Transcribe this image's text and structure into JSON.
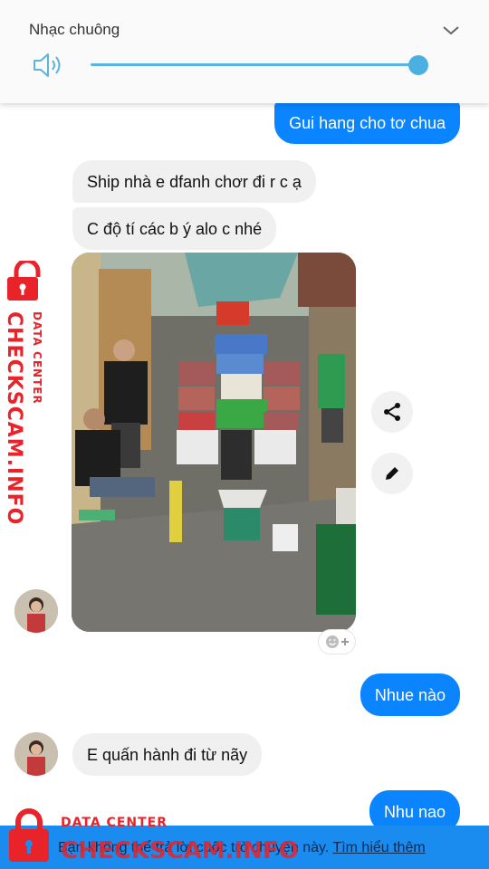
{
  "volume": {
    "title": "Nhạc chuông",
    "level_percent": 100,
    "icons": [
      "speaker-icon",
      "chevron-down-icon"
    ]
  },
  "messages": [
    {
      "side": "outgoing",
      "text": "Gui hang cho tơ chua"
    },
    {
      "side": "incoming",
      "text": "Ship nhà e dfanh chơr đi r c ạ"
    },
    {
      "side": "incoming",
      "text": "C độ tí các b ý alo c nhé"
    },
    {
      "side": "outgoing",
      "text": "Nhue nào"
    },
    {
      "side": "incoming",
      "text": "E quấn hành đi từ nãy"
    },
    {
      "side": "outgoing",
      "text": "Nhu nao"
    }
  ],
  "photo_actions": [
    "share-icon",
    "pencil-icon",
    "add-reaction-icon"
  ],
  "bottom_bar": {
    "text": "Bạn không thể trả lời cuộc trò chuyện này.",
    "link": "Tìm hiểu thêm"
  },
  "watermark": {
    "brand": "CHECKSCAM.INFO",
    "sub": "DATA CENTER"
  },
  "colors": {
    "outgoing_bubble": "#0a84ff",
    "incoming_bubble": "#f0f0f0",
    "bottom_bar": "#1a8cf0",
    "watermark": "#e8232a",
    "slider": "#4ab0e0"
  }
}
